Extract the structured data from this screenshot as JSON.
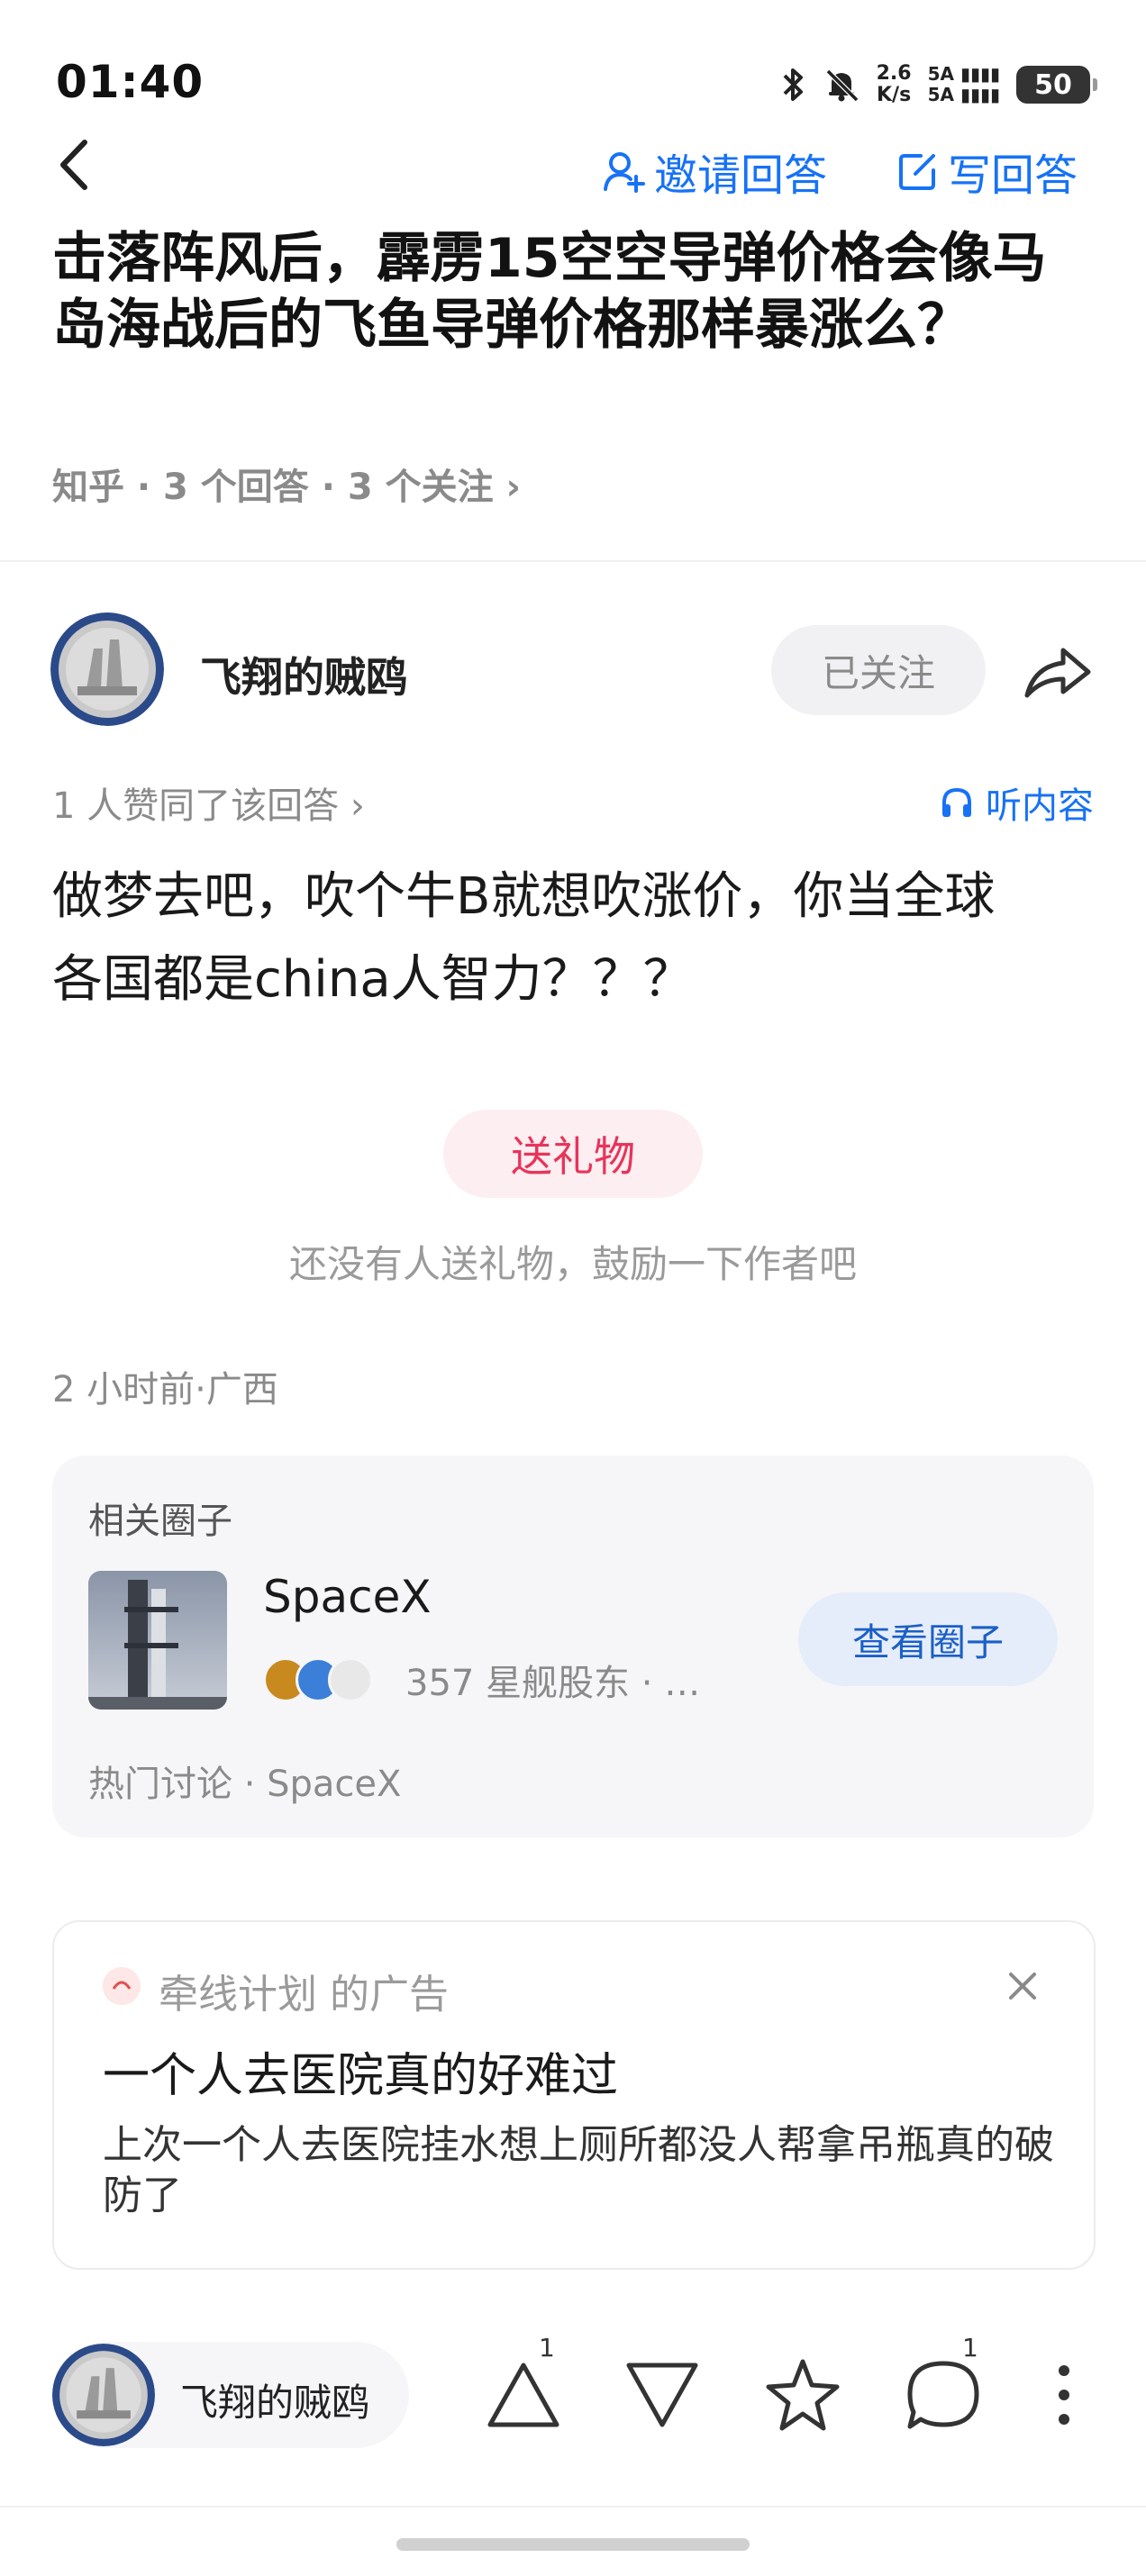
{
  "status_bar": {
    "time": "01:40",
    "net_speed_value": "2.6",
    "net_speed_unit": "K/s",
    "signal_1": "5A",
    "signal_2": "5A",
    "battery": "50"
  },
  "nav": {
    "invite_label": "邀请回答",
    "write_label": "写回答"
  },
  "question": {
    "title": "击落阵风后，霹雳15空空导弹价格会像马岛海战后的飞鱼导弹价格那样暴涨么？",
    "meta": "知乎 · 3 个回答 · 3 个关注 ›"
  },
  "answer": {
    "author_name": "飞翔的贼鸥",
    "follow_label": "已关注",
    "likes_text": "1 人赞同了该回答 ›",
    "listen_label": "听内容",
    "body_line1": "做梦去吧，吹个牛B就想吹涨价，你当全球",
    "body_line2": "各国都是china人智力？？？",
    "gift_button": "送礼物",
    "gift_hint": "还没有人送礼物，鼓励一下作者吧",
    "time_location": "2 小时前·广西"
  },
  "circle": {
    "header": "相关圈子",
    "name": "SpaceX",
    "members": "357 星舰股东 · …",
    "view_button": "查看圈子",
    "hot": "热门讨论 · SpaceX"
  },
  "ad": {
    "source": "牵线计划 的广告",
    "title": "一个人去医院真的好难过",
    "desc": "上次一个人去医院挂水想上厕所都没人帮拿吊瓶真的破防了"
  },
  "bottom_bar": {
    "author_name": "飞翔的贼鸥",
    "upvote_count": "1",
    "comment_count": "1"
  },
  "colors": {
    "accent_blue": "#1772f6",
    "gift_red": "#e8345a"
  }
}
